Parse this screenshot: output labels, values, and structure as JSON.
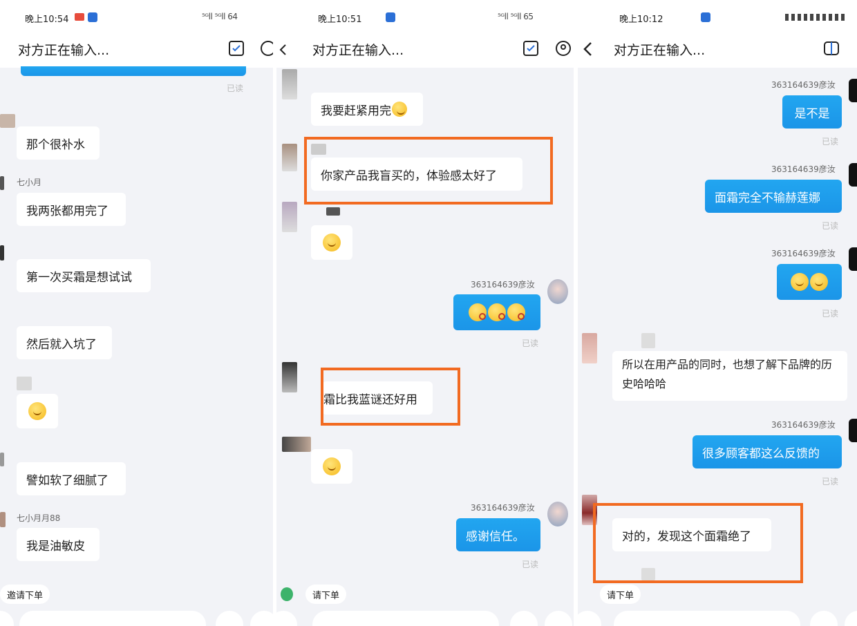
{
  "p1": {
    "status_time": "晚上10:54",
    "status_right": "⁵ᴳll ⁵ᴳll 64",
    "title": "对方正在输入...",
    "read_top": "已读",
    "messages": [
      "那个很补水",
      "我两张都用完了",
      "第一次买霜是想试试",
      "然后就入坑了",
      "譬如软了细腻了",
      "我是油敏皮"
    ],
    "names": [
      "七小月",
      "七小月月88"
    ],
    "chip": "邀请下单"
  },
  "p2": {
    "status_time": "晚上10:51",
    "status_right": "⁵ᴳll ⁵ᴳll 65",
    "title": "对方正在输入...",
    "messages": [
      "我要赶紧用完",
      "你家产品我盲买的，体验感太好了",
      "霜比我蓝谜还好用",
      "感谢信任。"
    ],
    "sender_name": "363164639彦汝",
    "read": "已读",
    "chip": "请下单"
  },
  "p3": {
    "status_time": "晚上10:12",
    "title": "对方正在输入...",
    "sender_name": "363164639彦汝",
    "read": "已读",
    "messages": [
      "是不是",
      "面霜完全不输赫莲娜",
      "所以在用产品的同时，也想了解下品牌的历史哈哈哈",
      "很多顾客都这么反馈的",
      "对的，发现这个面霜绝了"
    ],
    "chip": "请下单"
  },
  "colors": {
    "accent": "#1da1f2",
    "highlight_box": "#f26a21"
  }
}
